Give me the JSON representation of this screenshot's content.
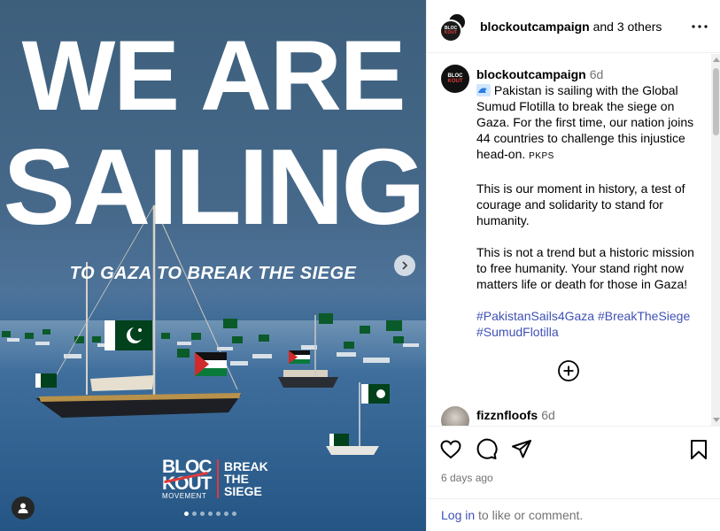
{
  "post_image": {
    "headline_line1": "WE ARE",
    "headline_line2": "SAILING",
    "subline": "TO GAZA TO BREAK THE SIEGE",
    "logo_left": "BLOC",
    "logo_left2": "KOUT",
    "logo_sub": "MOVEMENT",
    "logo_right": [
      "BREAK",
      "THE",
      "SIEGE"
    ],
    "carousel_count": 7,
    "carousel_active": 0
  },
  "header": {
    "username": "blockoutcampaign",
    "collab_text": "and 3 others",
    "more_icon": "more-horizontal-icon"
  },
  "caption": {
    "username": "blockoutcampaign",
    "time": "6d",
    "paragraph1": "Pakistan is sailing with the Global Sumud Flotilla to break the siege on Gaza. For the first time, our nation joins 44 countries to challenge this injustice head-on.",
    "flag_text": "PKPS",
    "paragraph2": "This is our moment in history, a test of courage and solidarity to stand for humanity.",
    "paragraph3": "This is not a trend but a historic mission to free humanity. Your stand right now matters life or death for those in Gaza!",
    "hashtags": [
      "#PakistanSails4Gaza",
      "#BreakTheSiege",
      "#SumudFlotilla"
    ]
  },
  "comment": {
    "username": "fizznfloofs",
    "time": "6d"
  },
  "actions": {
    "date": "6 days ago",
    "login_link": "Log in",
    "login_rest": " to like or comment."
  },
  "colors": {
    "accent_link": "#3f51b5",
    "muted": "#737373",
    "logo_red": "#e03a3a",
    "flag_green": "#01411c"
  }
}
